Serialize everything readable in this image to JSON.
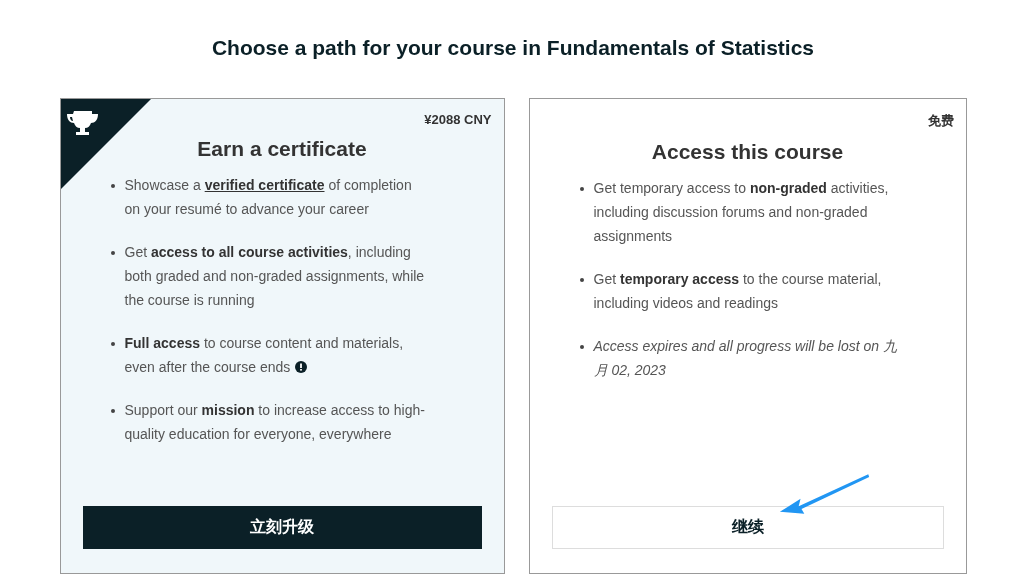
{
  "heading": "Choose a path for your course in Fundamentals of Statistics",
  "cards": [
    {
      "kind": "certificate",
      "price": "¥2088 CNY",
      "title": "Earn a certificate",
      "button": "立刻升级",
      "bullets": [
        {
          "italic": false,
          "info": false,
          "parts": [
            {
              "kind": "text",
              "text": "Showcase a "
            },
            {
              "kind": "link",
              "text": "verified certificate"
            },
            {
              "kind": "text",
              "text": " of completion on your resumé to advance your career"
            }
          ]
        },
        {
          "italic": false,
          "info": false,
          "parts": [
            {
              "kind": "text",
              "text": "Get "
            },
            {
              "kind": "bold",
              "text": "access to all course activities"
            },
            {
              "kind": "text",
              "text": ", including both graded and non-graded assignments, while the course is running"
            }
          ]
        },
        {
          "italic": false,
          "info": true,
          "parts": [
            {
              "kind": "bold",
              "text": "Full access"
            },
            {
              "kind": "text",
              "text": " to course content and materials, even after the course ends"
            }
          ]
        },
        {
          "italic": false,
          "info": false,
          "parts": [
            {
              "kind": "text",
              "text": "Support our "
            },
            {
              "kind": "bold",
              "text": "mission"
            },
            {
              "kind": "text",
              "text": " to increase access to high-quality education for everyone, everywhere"
            }
          ]
        }
      ]
    },
    {
      "kind": "audit",
      "price": "免费",
      "title": "Access this course",
      "button": "继续",
      "bullets": [
        {
          "italic": false,
          "info": false,
          "parts": [
            {
              "kind": "text",
              "text": "Get temporary access to "
            },
            {
              "kind": "bold",
              "text": "non-graded"
            },
            {
              "kind": "text",
              "text": " activities, including discussion forums and non-graded assignments"
            }
          ]
        },
        {
          "italic": false,
          "info": false,
          "parts": [
            {
              "kind": "text",
              "text": "Get "
            },
            {
              "kind": "bold",
              "text": "temporary access"
            },
            {
              "kind": "text",
              "text": " to the course material, including videos and readings"
            }
          ]
        },
        {
          "italic": true,
          "info": false,
          "parts": [
            {
              "kind": "text",
              "text": "Access expires and all progress will be lost on 九月 02, 2023"
            }
          ]
        }
      ]
    }
  ]
}
